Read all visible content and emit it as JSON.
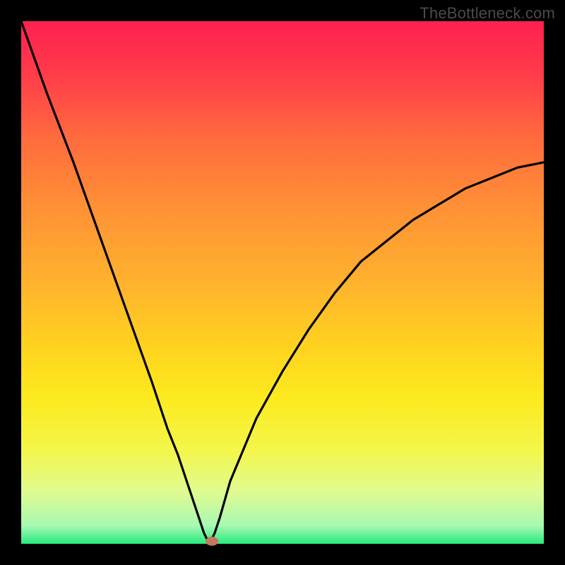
{
  "watermark": "TheBottleneck.com",
  "chart_data": {
    "type": "line",
    "title": "",
    "xlabel": "",
    "ylabel": "",
    "xlim": [
      0,
      100
    ],
    "ylim": [
      0,
      100
    ],
    "curve_description": "V-shaped bottleneck curve: steep descent from top-left to minimum near x≈36, then slower rise toward upper-right",
    "x": [
      0,
      5,
      10,
      15,
      20,
      25,
      28,
      30,
      32,
      34,
      35,
      36,
      37,
      38,
      40,
      45,
      50,
      55,
      60,
      65,
      70,
      75,
      80,
      85,
      90,
      95,
      100
    ],
    "y": [
      100,
      86,
      73,
      59,
      45,
      31,
      22,
      17,
      11,
      5,
      2,
      0,
      2,
      5,
      12,
      24,
      33,
      41,
      48,
      54,
      58,
      62,
      65,
      68,
      70,
      72,
      73
    ],
    "marker": {
      "x": 36.5,
      "y": 0.5
    },
    "inner_box": {
      "x0": 30,
      "y0": 30,
      "x1": 770,
      "y1": 770
    },
    "gradient_stops": [
      {
        "offset": 0.0,
        "color": "#ff2050"
      },
      {
        "offset": 0.1,
        "color": "#ff3b4a"
      },
      {
        "offset": 0.22,
        "color": "#ff6a3e"
      },
      {
        "offset": 0.35,
        "color": "#ff8f36"
      },
      {
        "offset": 0.5,
        "color": "#ffb22e"
      },
      {
        "offset": 0.62,
        "color": "#ffd21f"
      },
      {
        "offset": 0.72,
        "color": "#fcea1e"
      },
      {
        "offset": 0.82,
        "color": "#f4f64a"
      },
      {
        "offset": 0.9,
        "color": "#e0fb90"
      },
      {
        "offset": 0.965,
        "color": "#a8f9b2"
      },
      {
        "offset": 1.0,
        "color": "#28e980"
      }
    ]
  }
}
